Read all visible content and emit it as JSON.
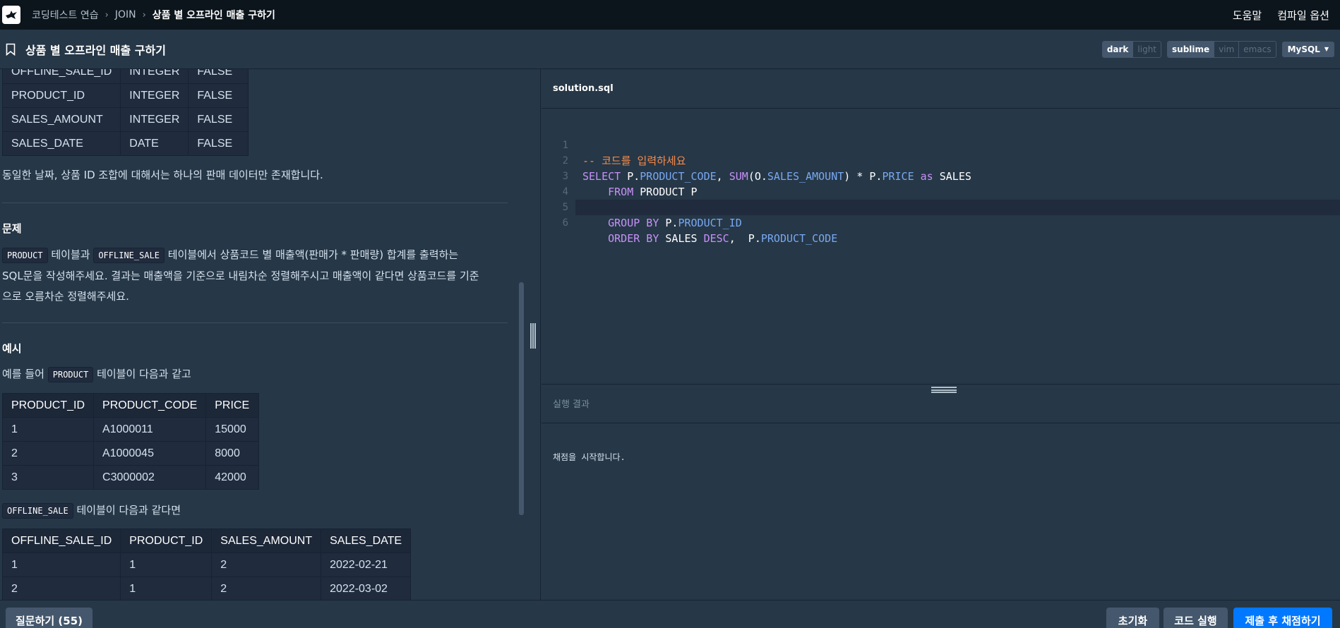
{
  "nav": {
    "breadcrumb": [
      "코딩테스트 연습",
      "JOIN",
      "상품 별 오프라인 매출 구하기"
    ],
    "help": "도움말",
    "compile_options": "컴파일 옵션"
  },
  "title": "상품 별 오프라인 매출 구하기",
  "theme_toggle": [
    "dark",
    "light"
  ],
  "keymap_toggle": [
    "sublime",
    "vim",
    "emacs"
  ],
  "language": "MySQL",
  "schema_rows": [
    [
      "OFFLINE_SALE_ID",
      "INTEGER",
      "FALSE"
    ],
    [
      "PRODUCT_ID",
      "INTEGER",
      "FALSE"
    ],
    [
      "SALES_AMOUNT",
      "INTEGER",
      "FALSE"
    ],
    [
      "SALES_DATE",
      "DATE",
      "FALSE"
    ]
  ],
  "note": "동일한 날짜, 상품 ID 조합에 대해서는 하나의 판매 데이터만 존재합니다.",
  "problem": {
    "heading": "문제",
    "code1": "PRODUCT",
    "text1": " 테이블과 ",
    "code2": "OFFLINE_SALE",
    "text2": " 테이블에서 상품코드 별 매출액(판매가 * 판매량) 합계를 출력하는",
    "line2": "SQL문을 작성해주세요. 결과는 매출액을 기준으로 내림차순 정렬해주시고 매출액이 같다면 상품코드를 기준",
    "line3": "으로 오름차순 정렬해주세요."
  },
  "example": {
    "heading": "예시",
    "intro_prefix": "예를 들어 ",
    "intro_code": "PRODUCT",
    "intro_suffix": " 테이블이 다음과 같고",
    "product_headers": [
      "PRODUCT_ID",
      "PRODUCT_CODE",
      "PRICE"
    ],
    "product_rows": [
      [
        "1",
        "A1000011",
        "15000"
      ],
      [
        "2",
        "A1000045",
        "8000"
      ],
      [
        "3",
        "C3000002",
        "42000"
      ]
    ],
    "sale_intro_code": "OFFLINE_SALE",
    "sale_intro_suffix": " 테이블이 다음과 같다면",
    "sale_headers": [
      "OFFLINE_SALE_ID",
      "PRODUCT_ID",
      "SALES_AMOUNT",
      "SALES_DATE"
    ],
    "sale_rows": [
      [
        "1",
        "1",
        "2",
        "2022-02-21"
      ],
      [
        "2",
        "1",
        "2",
        "2022-03-02"
      ]
    ]
  },
  "editor": {
    "filename": "solution.sql",
    "line_numbers": [
      "1",
      "2",
      "3",
      "4",
      "5",
      "6"
    ]
  },
  "result": {
    "heading": "실행 결과",
    "message": "채점을 시작합니다."
  },
  "footer": {
    "question_button": "질문하기 (55)",
    "reset_button": "초기화",
    "run_button": "코드 실행",
    "submit_button": "제출 후 채점하기"
  }
}
